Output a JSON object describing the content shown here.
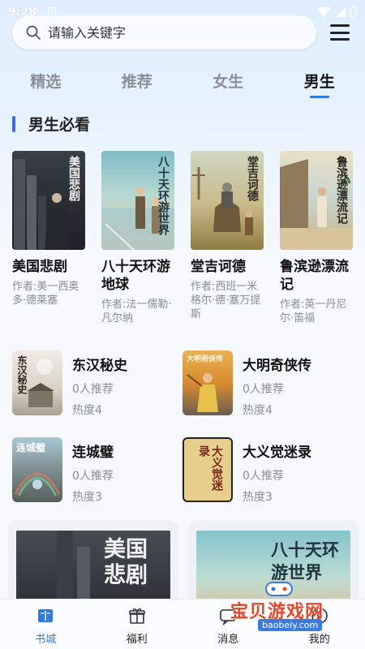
{
  "status_bar": {
    "time": "9:28",
    "notif": "A"
  },
  "search": {
    "placeholder": "请输入关键字"
  },
  "tabs": [
    {
      "label": "精选"
    },
    {
      "label": "推荐"
    },
    {
      "label": "女生"
    },
    {
      "label": "男生",
      "active": true
    }
  ],
  "section": {
    "title": "男生必看"
  },
  "featured": [
    {
      "title": "美国悲剧",
      "cover_text": "美国悲剧",
      "author": "作者:美一西奥多·德莱塞"
    },
    {
      "title": "八十天环游地球",
      "cover_text": "八十天环游世界",
      "author": "作者:法一儒勒·凡尔纳"
    },
    {
      "title": "堂吉诃德",
      "cover_text": "堂吉诃德",
      "author": "作者:西班一米格尔·德·塞万提斯"
    },
    {
      "title": "鲁滨逊漂流记",
      "cover_text": "鲁滨逊漂流记",
      "author": "作者:英一丹尼尔·笛福"
    }
  ],
  "list": [
    {
      "name": "东汉秘史",
      "cover_text": "东汉秘史",
      "recommend": "0人推荐",
      "heat": "热度4"
    },
    {
      "name": "大明奇侠传",
      "cover_text": "大明奇侠传",
      "recommend": "0人推荐",
      "heat": "热度4"
    },
    {
      "name": "连城璧",
      "cover_text": "连城璧",
      "recommend": "0人推荐",
      "heat": "热度3"
    },
    {
      "name": "大义觉迷录",
      "cover_text": "大义觉迷录",
      "recommend": "0人推荐",
      "heat": "热度3"
    }
  ],
  "banners": [
    {
      "text": "美国悲剧"
    },
    {
      "text": "八十天环游世界"
    }
  ],
  "bottom_nav": [
    {
      "label": "书城",
      "icon": "book-icon",
      "active": true
    },
    {
      "label": "福利",
      "icon": "gift-icon"
    },
    {
      "label": "消息",
      "icon": "message-icon"
    },
    {
      "label": "我的",
      "icon": "user-icon"
    }
  ],
  "watermark": {
    "title": "宝贝游戏网",
    "url": "baobeiy.com"
  },
  "colors": {
    "accent": "#2f7de1",
    "section_bar": "#3a6be8",
    "muted": "#8a8f98"
  }
}
